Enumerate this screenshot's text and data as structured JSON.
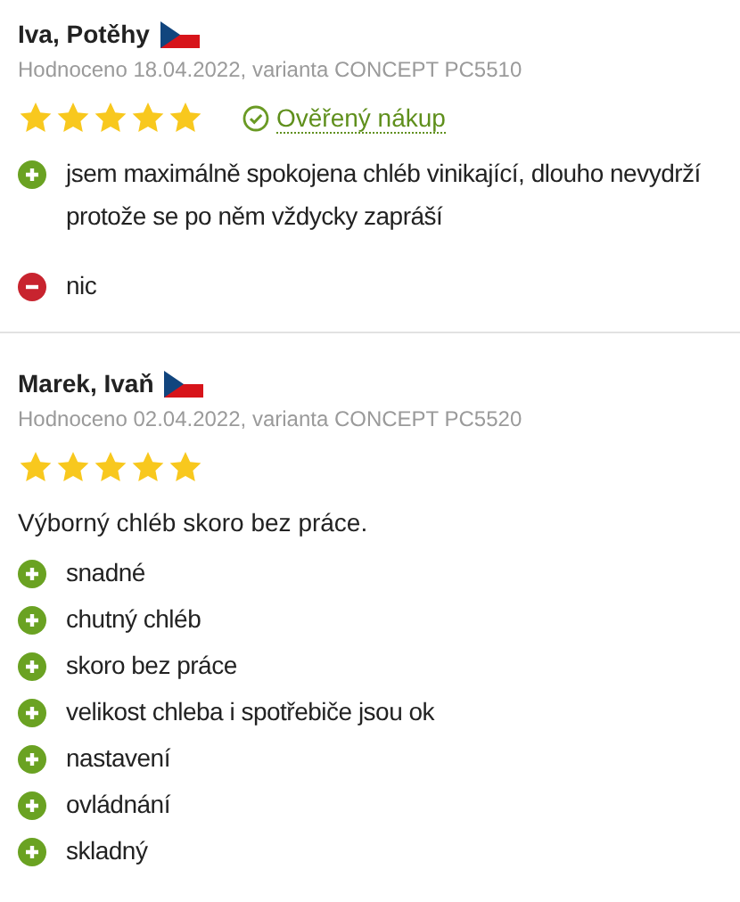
{
  "reviews": [
    {
      "author": "Iva, Potěhy",
      "meta": "Hodnoceno 18.04.2022, varianta CONCEPT PC5510",
      "stars": 5,
      "verified": "Ověřený nákup",
      "points": [
        {
          "kind": "pro",
          "text": "jsem maximálně spokojena chléb vinikající, dlouho nevydrží protože se po něm vždycky zapráší"
        },
        {
          "kind": "con",
          "text": "nic"
        }
      ]
    },
    {
      "author": "Marek, Ivaň",
      "meta": "Hodnoceno 02.04.2022, varianta CONCEPT PC5520",
      "stars": 5,
      "summary": "Výborný chléb skoro bez práce.",
      "points": [
        {
          "kind": "pro",
          "text": "snadné"
        },
        {
          "kind": "pro",
          "text": "chutný chléb"
        },
        {
          "kind": "pro",
          "text": "skoro bez práce"
        },
        {
          "kind": "pro",
          "text": "velikost chleba i spotřebiče jsou ok"
        },
        {
          "kind": "pro",
          "text": "nastavení"
        },
        {
          "kind": "pro",
          "text": "ovládnání"
        },
        {
          "kind": "pro",
          "text": "skladný"
        }
      ]
    }
  ]
}
